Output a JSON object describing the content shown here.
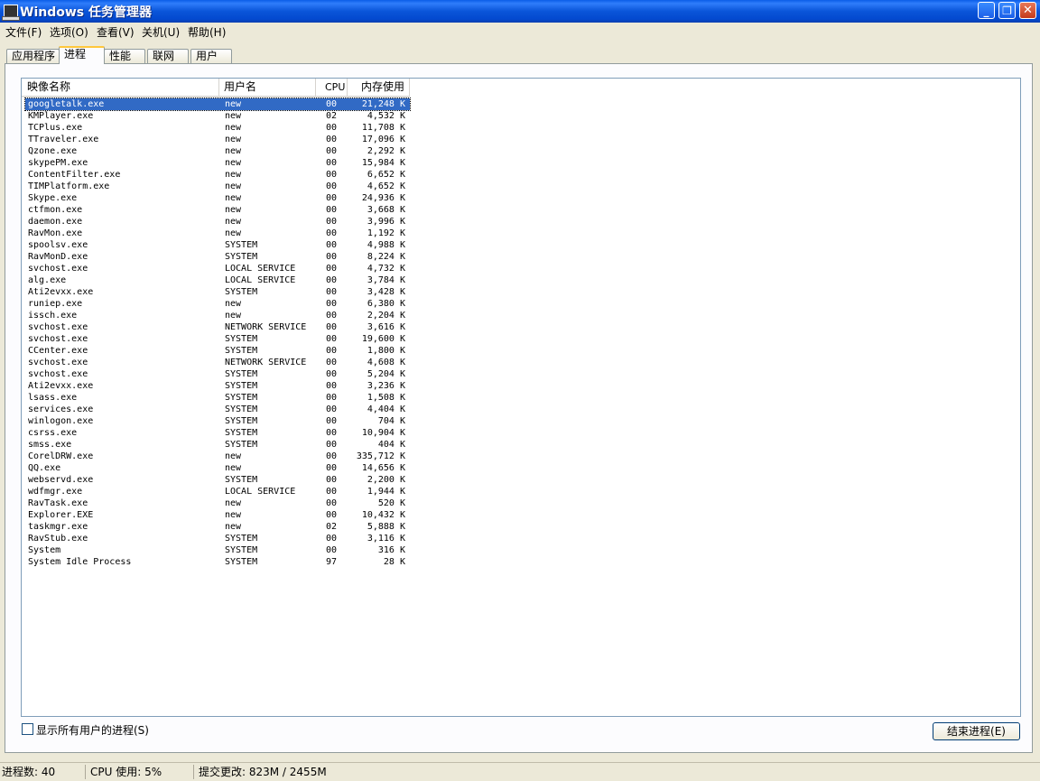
{
  "window": {
    "title": "Windows 任务管理器",
    "minimize_glyph": "_",
    "maximize_glyph": "❐",
    "close_glyph": "✕"
  },
  "menu": [
    "文件(F)",
    "选项(O)",
    "查看(V)",
    "关机(U)",
    "帮助(H)"
  ],
  "tabs": [
    "应用程序",
    "进程",
    "性能",
    "联网",
    "用户"
  ],
  "active_tab": "进程",
  "columns": [
    "映像名称",
    "用户名",
    "CPU",
    "内存使用"
  ],
  "processes": [
    [
      "googletalk.exe",
      "new",
      "00",
      "21,248 K"
    ],
    [
      "KMPlayer.exe",
      "new",
      "02",
      "4,532 K"
    ],
    [
      "TCPlus.exe",
      "new",
      "00",
      "11,708 K"
    ],
    [
      "TTraveler.exe",
      "new",
      "00",
      "17,096 K"
    ],
    [
      "Qzone.exe",
      "new",
      "00",
      "2,292 K"
    ],
    [
      "skypePM.exe",
      "new",
      "00",
      "15,984 K"
    ],
    [
      "ContentFilter.exe",
      "new",
      "00",
      "6,652 K"
    ],
    [
      "TIMPlatform.exe",
      "new",
      "00",
      "4,652 K"
    ],
    [
      "Skype.exe",
      "new",
      "00",
      "24,936 K"
    ],
    [
      "ctfmon.exe",
      "new",
      "00",
      "3,668 K"
    ],
    [
      "daemon.exe",
      "new",
      "00",
      "3,996 K"
    ],
    [
      "RavMon.exe",
      "new",
      "00",
      "1,192 K"
    ],
    [
      "spoolsv.exe",
      "SYSTEM",
      "00",
      "4,988 K"
    ],
    [
      "RavMonD.exe",
      "SYSTEM",
      "00",
      "8,224 K"
    ],
    [
      "svchost.exe",
      "LOCAL SERVICE",
      "00",
      "4,732 K"
    ],
    [
      "alg.exe",
      "LOCAL SERVICE",
      "00",
      "3,784 K"
    ],
    [
      "Ati2evxx.exe",
      "SYSTEM",
      "00",
      "3,428 K"
    ],
    [
      "runiep.exe",
      "new",
      "00",
      "6,380 K"
    ],
    [
      "issch.exe",
      "new",
      "00",
      "2,204 K"
    ],
    [
      "svchost.exe",
      "NETWORK SERVICE",
      "00",
      "3,616 K"
    ],
    [
      "svchost.exe",
      "SYSTEM",
      "00",
      "19,600 K"
    ],
    [
      "CCenter.exe",
      "SYSTEM",
      "00",
      "1,800 K"
    ],
    [
      "svchost.exe",
      "NETWORK SERVICE",
      "00",
      "4,608 K"
    ],
    [
      "svchost.exe",
      "SYSTEM",
      "00",
      "5,204 K"
    ],
    [
      "Ati2evxx.exe",
      "SYSTEM",
      "00",
      "3,236 K"
    ],
    [
      "lsass.exe",
      "SYSTEM",
      "00",
      "1,508 K"
    ],
    [
      "services.exe",
      "SYSTEM",
      "00",
      "4,404 K"
    ],
    [
      "winlogon.exe",
      "SYSTEM",
      "00",
      "704 K"
    ],
    [
      "csrss.exe",
      "SYSTEM",
      "00",
      "10,904 K"
    ],
    [
      "smss.exe",
      "SYSTEM",
      "00",
      "404 K"
    ],
    [
      "CorelDRW.exe",
      "new",
      "00",
      "335,712 K"
    ],
    [
      "QQ.exe",
      "new",
      "00",
      "14,656 K"
    ],
    [
      "webservd.exe",
      "SYSTEM",
      "00",
      "2,200 K"
    ],
    [
      "wdfmgr.exe",
      "LOCAL SERVICE",
      "00",
      "1,944 K"
    ],
    [
      "RavTask.exe",
      "new",
      "00",
      "520 K"
    ],
    [
      "Explorer.EXE",
      "new",
      "00",
      "10,432 K"
    ],
    [
      "taskmgr.exe",
      "new",
      "02",
      "5,888 K"
    ],
    [
      "RavStub.exe",
      "SYSTEM",
      "00",
      "3,116 K"
    ],
    [
      "System",
      "SYSTEM",
      "00",
      "316 K"
    ],
    [
      "System Idle Process",
      "SYSTEM",
      "97",
      "28 K"
    ]
  ],
  "selected_process": "googletalk.exe",
  "show_all_users_label": "显示所有用户的进程(S)",
  "show_all_users_checked": false,
  "end_process_label": "结束进程(E)",
  "status": {
    "processes": "进程数: 40",
    "cpu": "CPU 使用: 5%",
    "commit": "提交更改: 823M / 2455M"
  }
}
